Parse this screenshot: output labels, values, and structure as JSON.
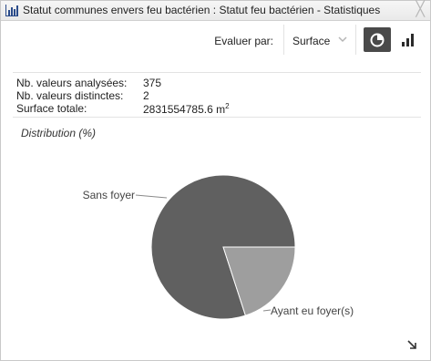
{
  "window": {
    "title": "Statut communes envers feu bactérien : Statut feu bactérien - Statistiques",
    "close_label": "╳"
  },
  "toolbar": {
    "evaluate_label": "Evaluer par:",
    "evaluate_value": "Surface",
    "pie_button_icon": "pie-chart-icon",
    "bar_button_icon": "bar-chart-icon"
  },
  "stats": {
    "rows": [
      {
        "key": "Nb. valeurs analysées:",
        "value": "375"
      },
      {
        "key": "Nb. valeurs distinctes:",
        "value": "2"
      },
      {
        "key": "Surface totale:",
        "value": "2831554785.6 m",
        "unit_sup": "2"
      }
    ]
  },
  "distribution": {
    "title": "Distribution (%)"
  },
  "chart_data": {
    "type": "pie",
    "categories": [
      "Sans foyer",
      "Ayant eu foyer(s)"
    ],
    "values": [
      80,
      20
    ],
    "colors": [
      "#606060",
      "#9e9e9e"
    ]
  },
  "colors": {
    "title_bg": "#ececec",
    "active_button": "#4a4a4a",
    "slice_dark": "#606060",
    "slice_light": "#9e9e9e"
  }
}
